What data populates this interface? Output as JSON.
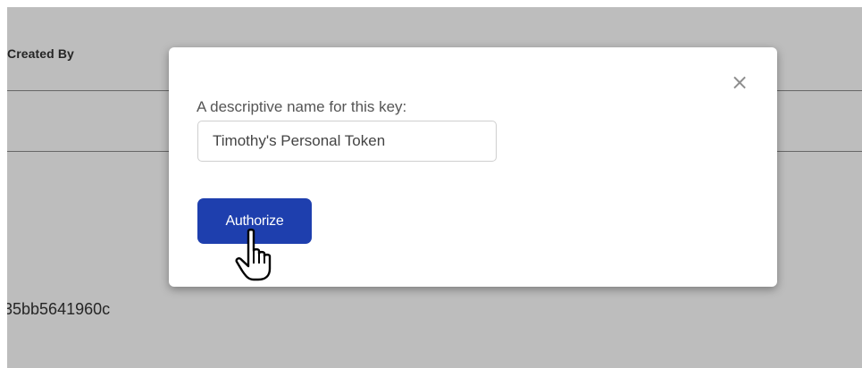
{
  "background": {
    "column_header": "Created By",
    "key_fragment": "35bb5641960c"
  },
  "modal": {
    "close_glyph": "×",
    "field_label": "A descriptive name for this key:",
    "name_input_value": "Timothy's Personal Token",
    "authorize_label": "Authorize"
  },
  "colors": {
    "overlay": "#bdbdbd",
    "button": "#1e3fae",
    "modal_bg": "#ffffff"
  },
  "icons": {
    "close": "close-icon",
    "cursor": "hand-pointer-icon"
  }
}
